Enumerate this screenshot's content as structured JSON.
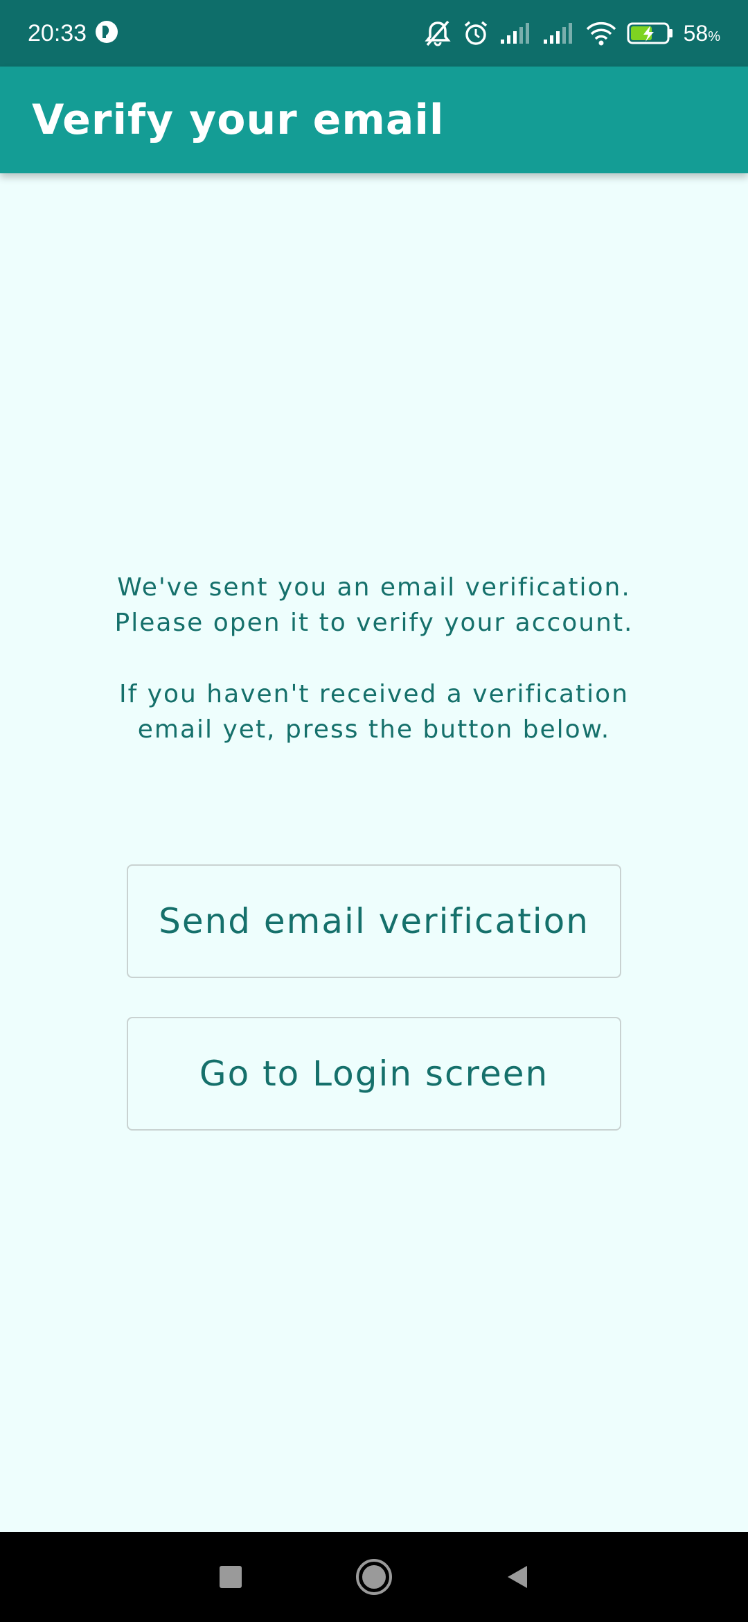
{
  "status_bar": {
    "time": "20:33",
    "battery_percent": "58",
    "battery_unit": "%",
    "icons": [
      "app-notification-icon",
      "bell-muted-icon",
      "alarm-icon",
      "signal-icon",
      "signal-icon",
      "wifi-icon",
      "battery-charging-icon"
    ]
  },
  "app_bar": {
    "title": "Verify your email"
  },
  "main": {
    "message_line1": "We've sent you an email verification.",
    "message_line2": "Please open it to verify your account.",
    "message_line3": "If you haven't received a verification",
    "message_line4": "email yet, press the button below.",
    "send_button_label": "Send email verification",
    "login_button_label": "Go to Login screen"
  },
  "nav_bar": {
    "icons": [
      "recents-square-icon",
      "home-circle-icon",
      "back-triangle-icon"
    ]
  },
  "colors": {
    "status_bar": "#0E6E6A",
    "app_bar": "#149D95",
    "background": "#EEFEFD",
    "text_accent": "#15706B",
    "button_border": "#C9D2D1",
    "battery_charge": "#7ED321"
  }
}
